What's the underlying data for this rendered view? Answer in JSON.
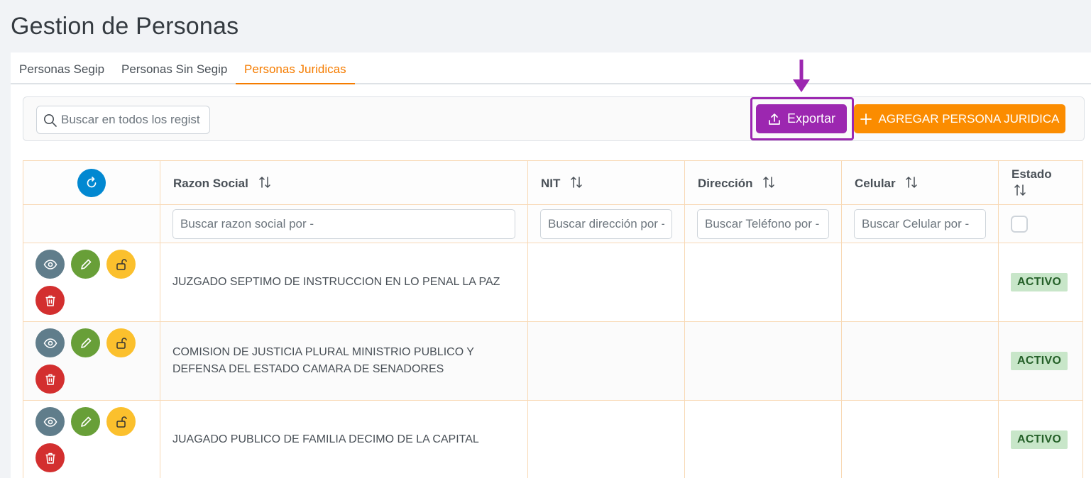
{
  "page": {
    "title": "Gestion de Personas"
  },
  "tabs": [
    {
      "label": "Personas Segip",
      "active": false
    },
    {
      "label": "Personas Sin Segip",
      "active": false
    },
    {
      "label": "Personas Juridicas",
      "active": true
    }
  ],
  "toolbar": {
    "search_placeholder": "Buscar en todos los regist",
    "export_label": "Exportar",
    "add_label": "AGREGAR PERSONA JURIDICA"
  },
  "table": {
    "columns": [
      {
        "label": "Razon Social",
        "filter_placeholder": "Buscar razon social por -"
      },
      {
        "label": "NIT",
        "filter_placeholder": "Buscar dirección por -"
      },
      {
        "label": "Dirección",
        "filter_placeholder": "Buscar Teléfono por -"
      },
      {
        "label": "Celular",
        "filter_placeholder": "Buscar Celular por -"
      },
      {
        "label": "Estado"
      }
    ],
    "rows": [
      {
        "razon_social": "JUZGADO SEPTIMO DE INSTRUCCION EN LO PENAL LA PAZ",
        "nit": "",
        "direccion": "",
        "celular": "",
        "estado": "ACTIVO"
      },
      {
        "razon_social": "COMISION DE JUSTICIA PLURAL MINISTRIO PUBLICO Y DEFENSA DEL ESTADO CAMARA DE SENADORES",
        "nit": "",
        "direccion": "",
        "celular": "",
        "estado": "ACTIVO"
      },
      {
        "razon_social": "JUAGADO PUBLICO DE FAMILIA DECIMO DE LA CAPITAL",
        "nit": "",
        "direccion": "",
        "celular": "",
        "estado": "ACTIVO"
      }
    ]
  },
  "icons": {
    "search": "search-icon",
    "upload": "upload-icon",
    "plus": "plus-icon",
    "refresh": "refresh-icon",
    "sort": "sort-icon",
    "view": "eye-icon",
    "edit": "pencil-icon",
    "lock": "unlock-icon",
    "delete": "trash-icon",
    "annotation": "arrow-down-icon"
  },
  "colors": {
    "accent": "#f57c00",
    "export": "#9c27b0",
    "add": "#fb8c00",
    "refresh": "#0288d1",
    "view": "#607d8b",
    "edit": "#689f38",
    "lock": "#fbc02d",
    "delete": "#d32f2f",
    "status_bg": "#c8e6c9",
    "status_fg": "#256029"
  }
}
